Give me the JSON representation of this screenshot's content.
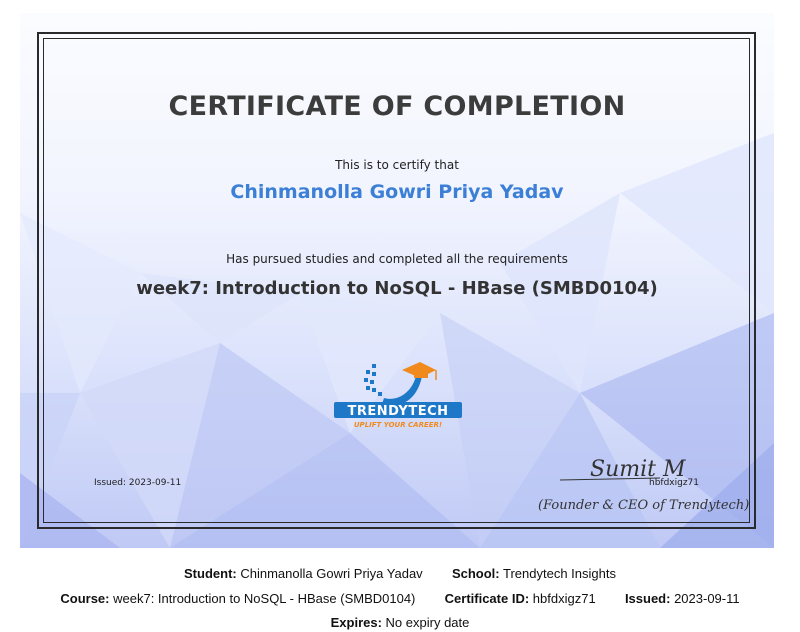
{
  "certificate": {
    "title": "CERTIFICATE OF COMPLETION",
    "certify_text": "This is to certify that",
    "student_name": "Chinmanolla Gowri Priya Yadav",
    "pursued_text": "Has pursued studies and completed all the requirements",
    "course_title": "week7: Introduction to NoSQL - HBase (SMBD0104)",
    "issued_label": "Issued: 2023-09-11",
    "certificate_id": "hbfdxigz71",
    "signature": "Sumit M",
    "signatory": "(Founder & CEO of Trendytech)",
    "logo": {
      "name": "TRENDYTECH",
      "tagline": "UPLIFT YOUR CAREER!",
      "icon": "graduation-cap-icon"
    }
  },
  "info": {
    "student_label": "Student:",
    "student_value": "Chinmanolla Gowri Priya Yadav",
    "school_label": "School:",
    "school_value": "Trendytech Insights",
    "course_label": "Course:",
    "course_value": "week7: Introduction to NoSQL - HBase (SMBD0104)",
    "certificate_id_label": "Certificate ID:",
    "certificate_id_value": "hbfdxigz71",
    "issued_label": "Issued:",
    "issued_value": "2023-09-11",
    "expires_label": "Expires:",
    "expires_value": "No expiry date"
  },
  "colors": {
    "name_blue": "#3b7fd6",
    "logo_blue": "#1e78c8",
    "logo_orange": "#f08a1c"
  }
}
